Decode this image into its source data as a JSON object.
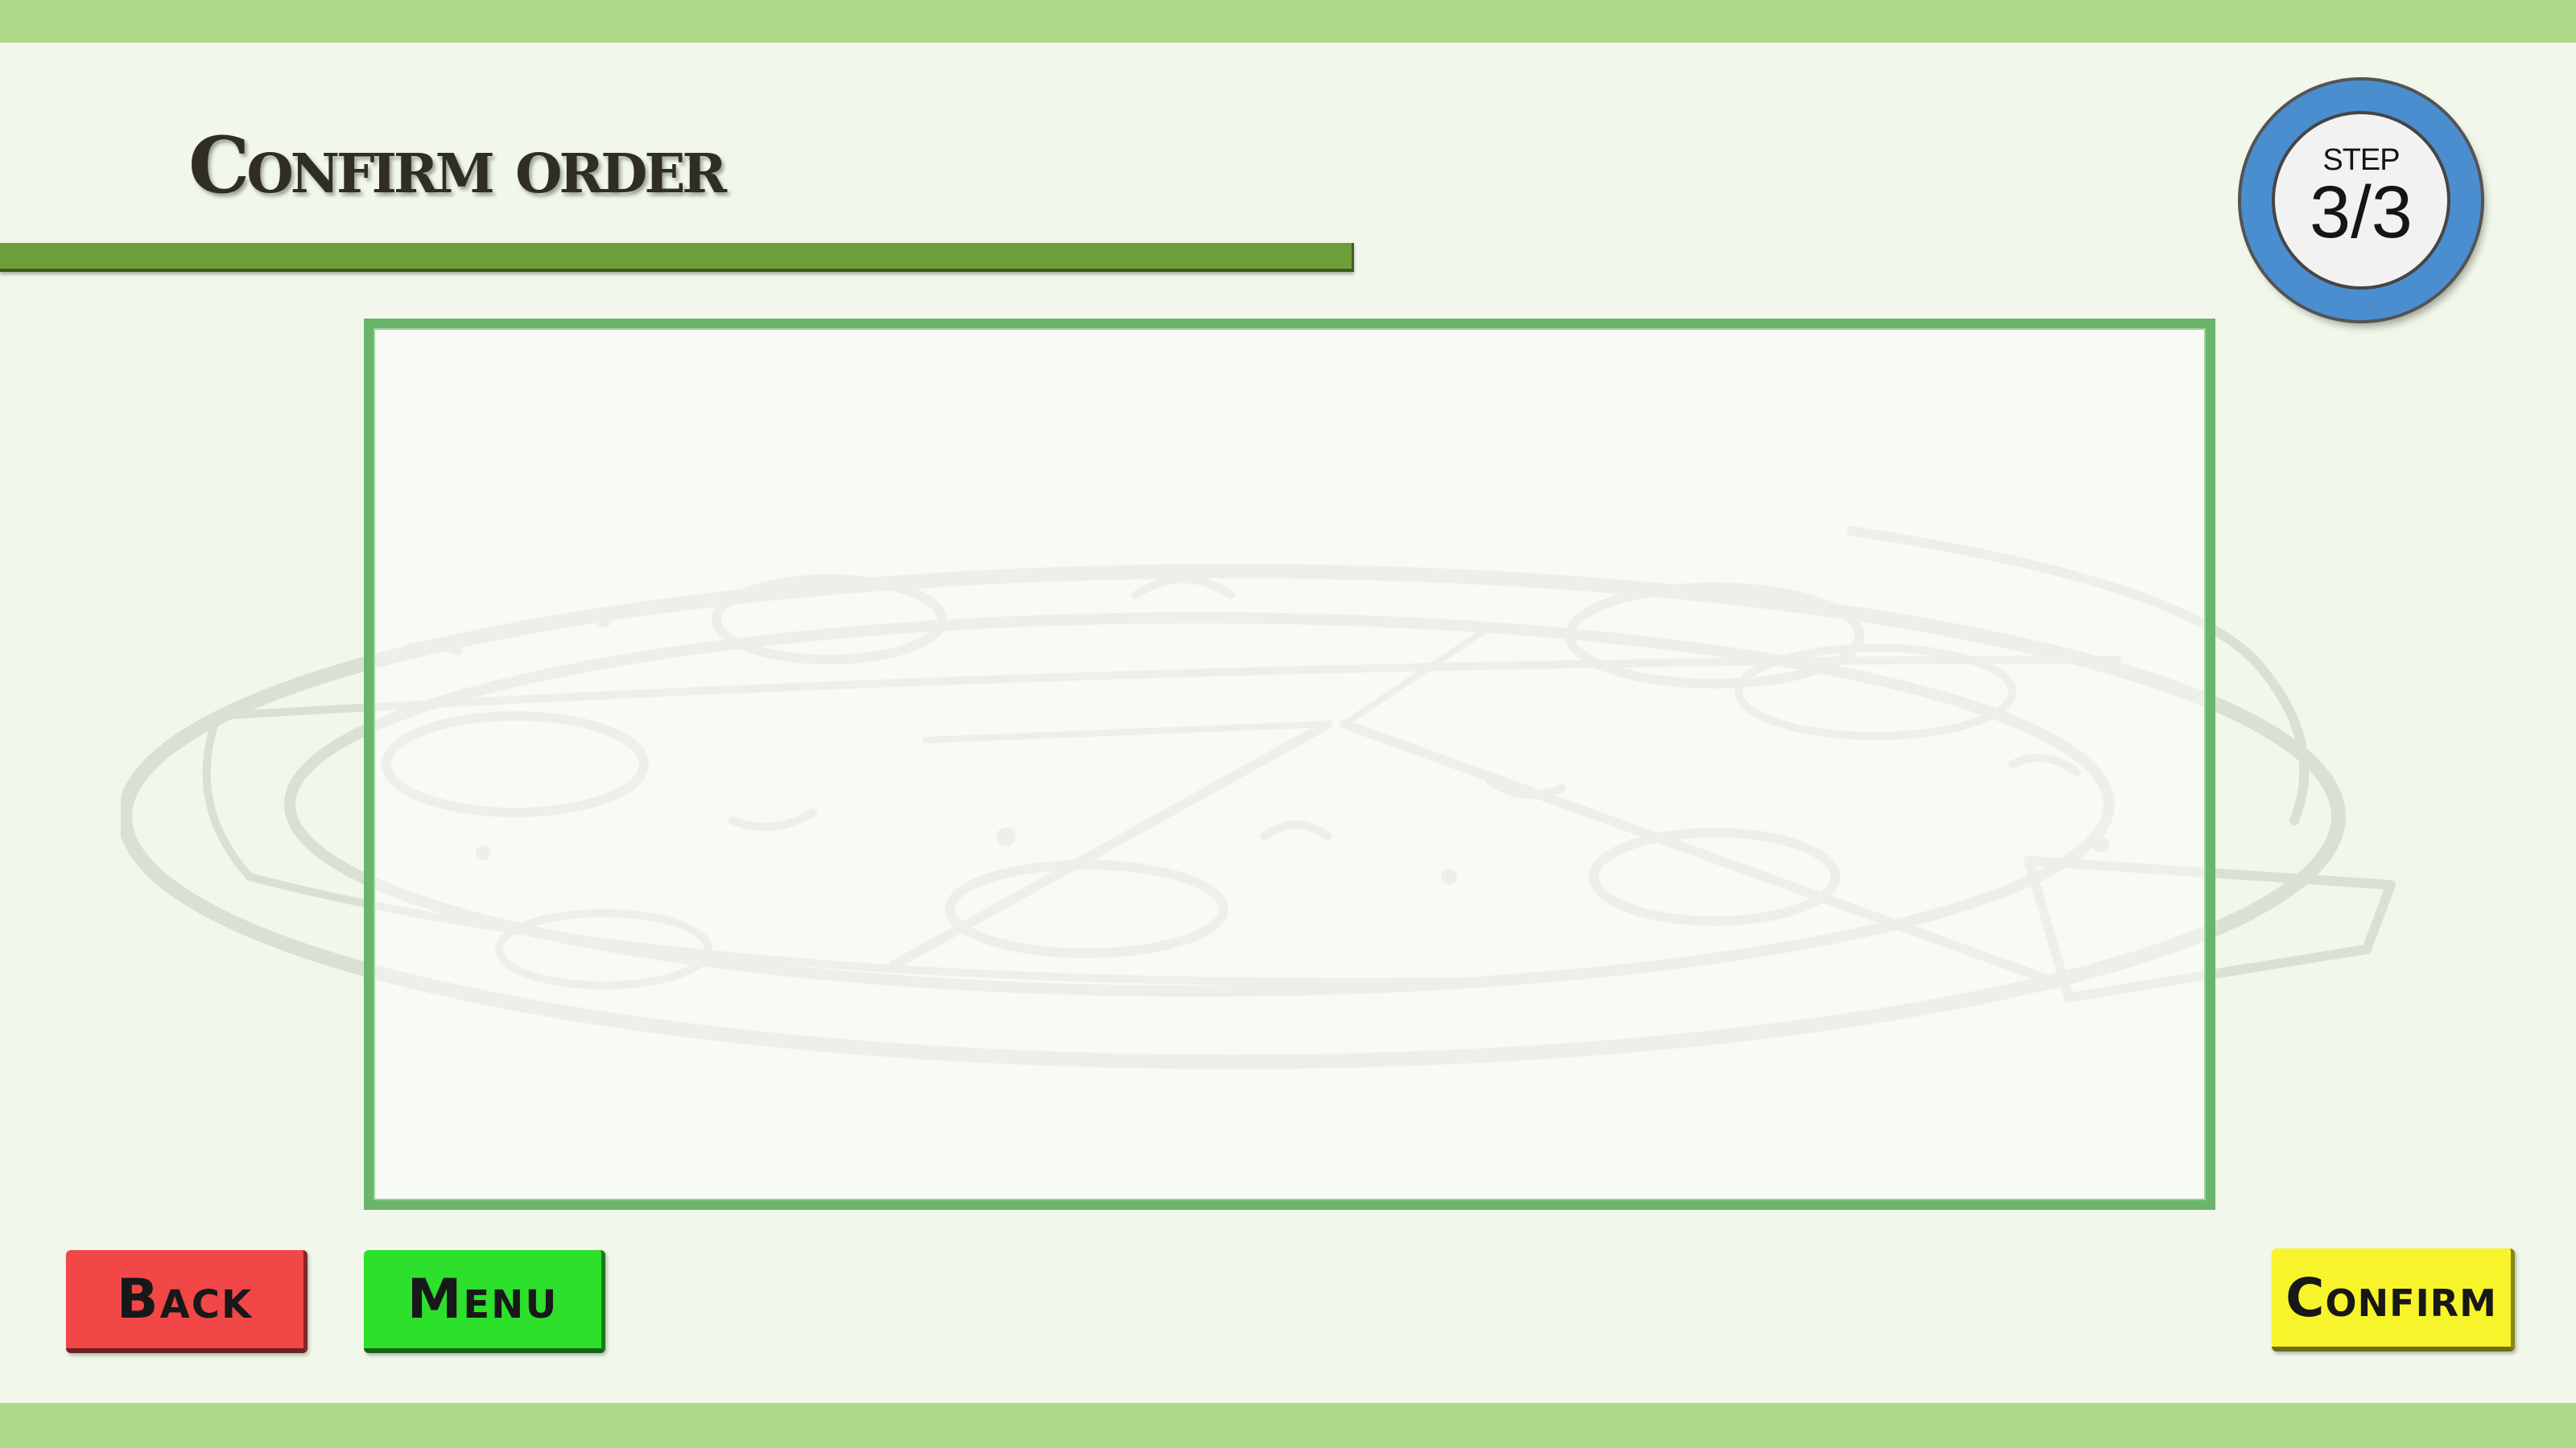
{
  "header": {
    "title": "Confirm order"
  },
  "step": {
    "label": "STEP",
    "value": "3/3"
  },
  "buttons": {
    "back": "Back",
    "menu": "Menu",
    "confirm": "Confirm"
  },
  "watermark": {
    "icon": "pizza-icon"
  },
  "colors": {
    "background": "#f1f7ea",
    "bars": "#afd789",
    "title_underline": "#6c9f39",
    "panel_border": "#6ab56b",
    "step_ring": "#4b8ed0",
    "back_button": "#f24747",
    "menu_button": "#2de02c",
    "confirm_button": "#f8f42b"
  }
}
